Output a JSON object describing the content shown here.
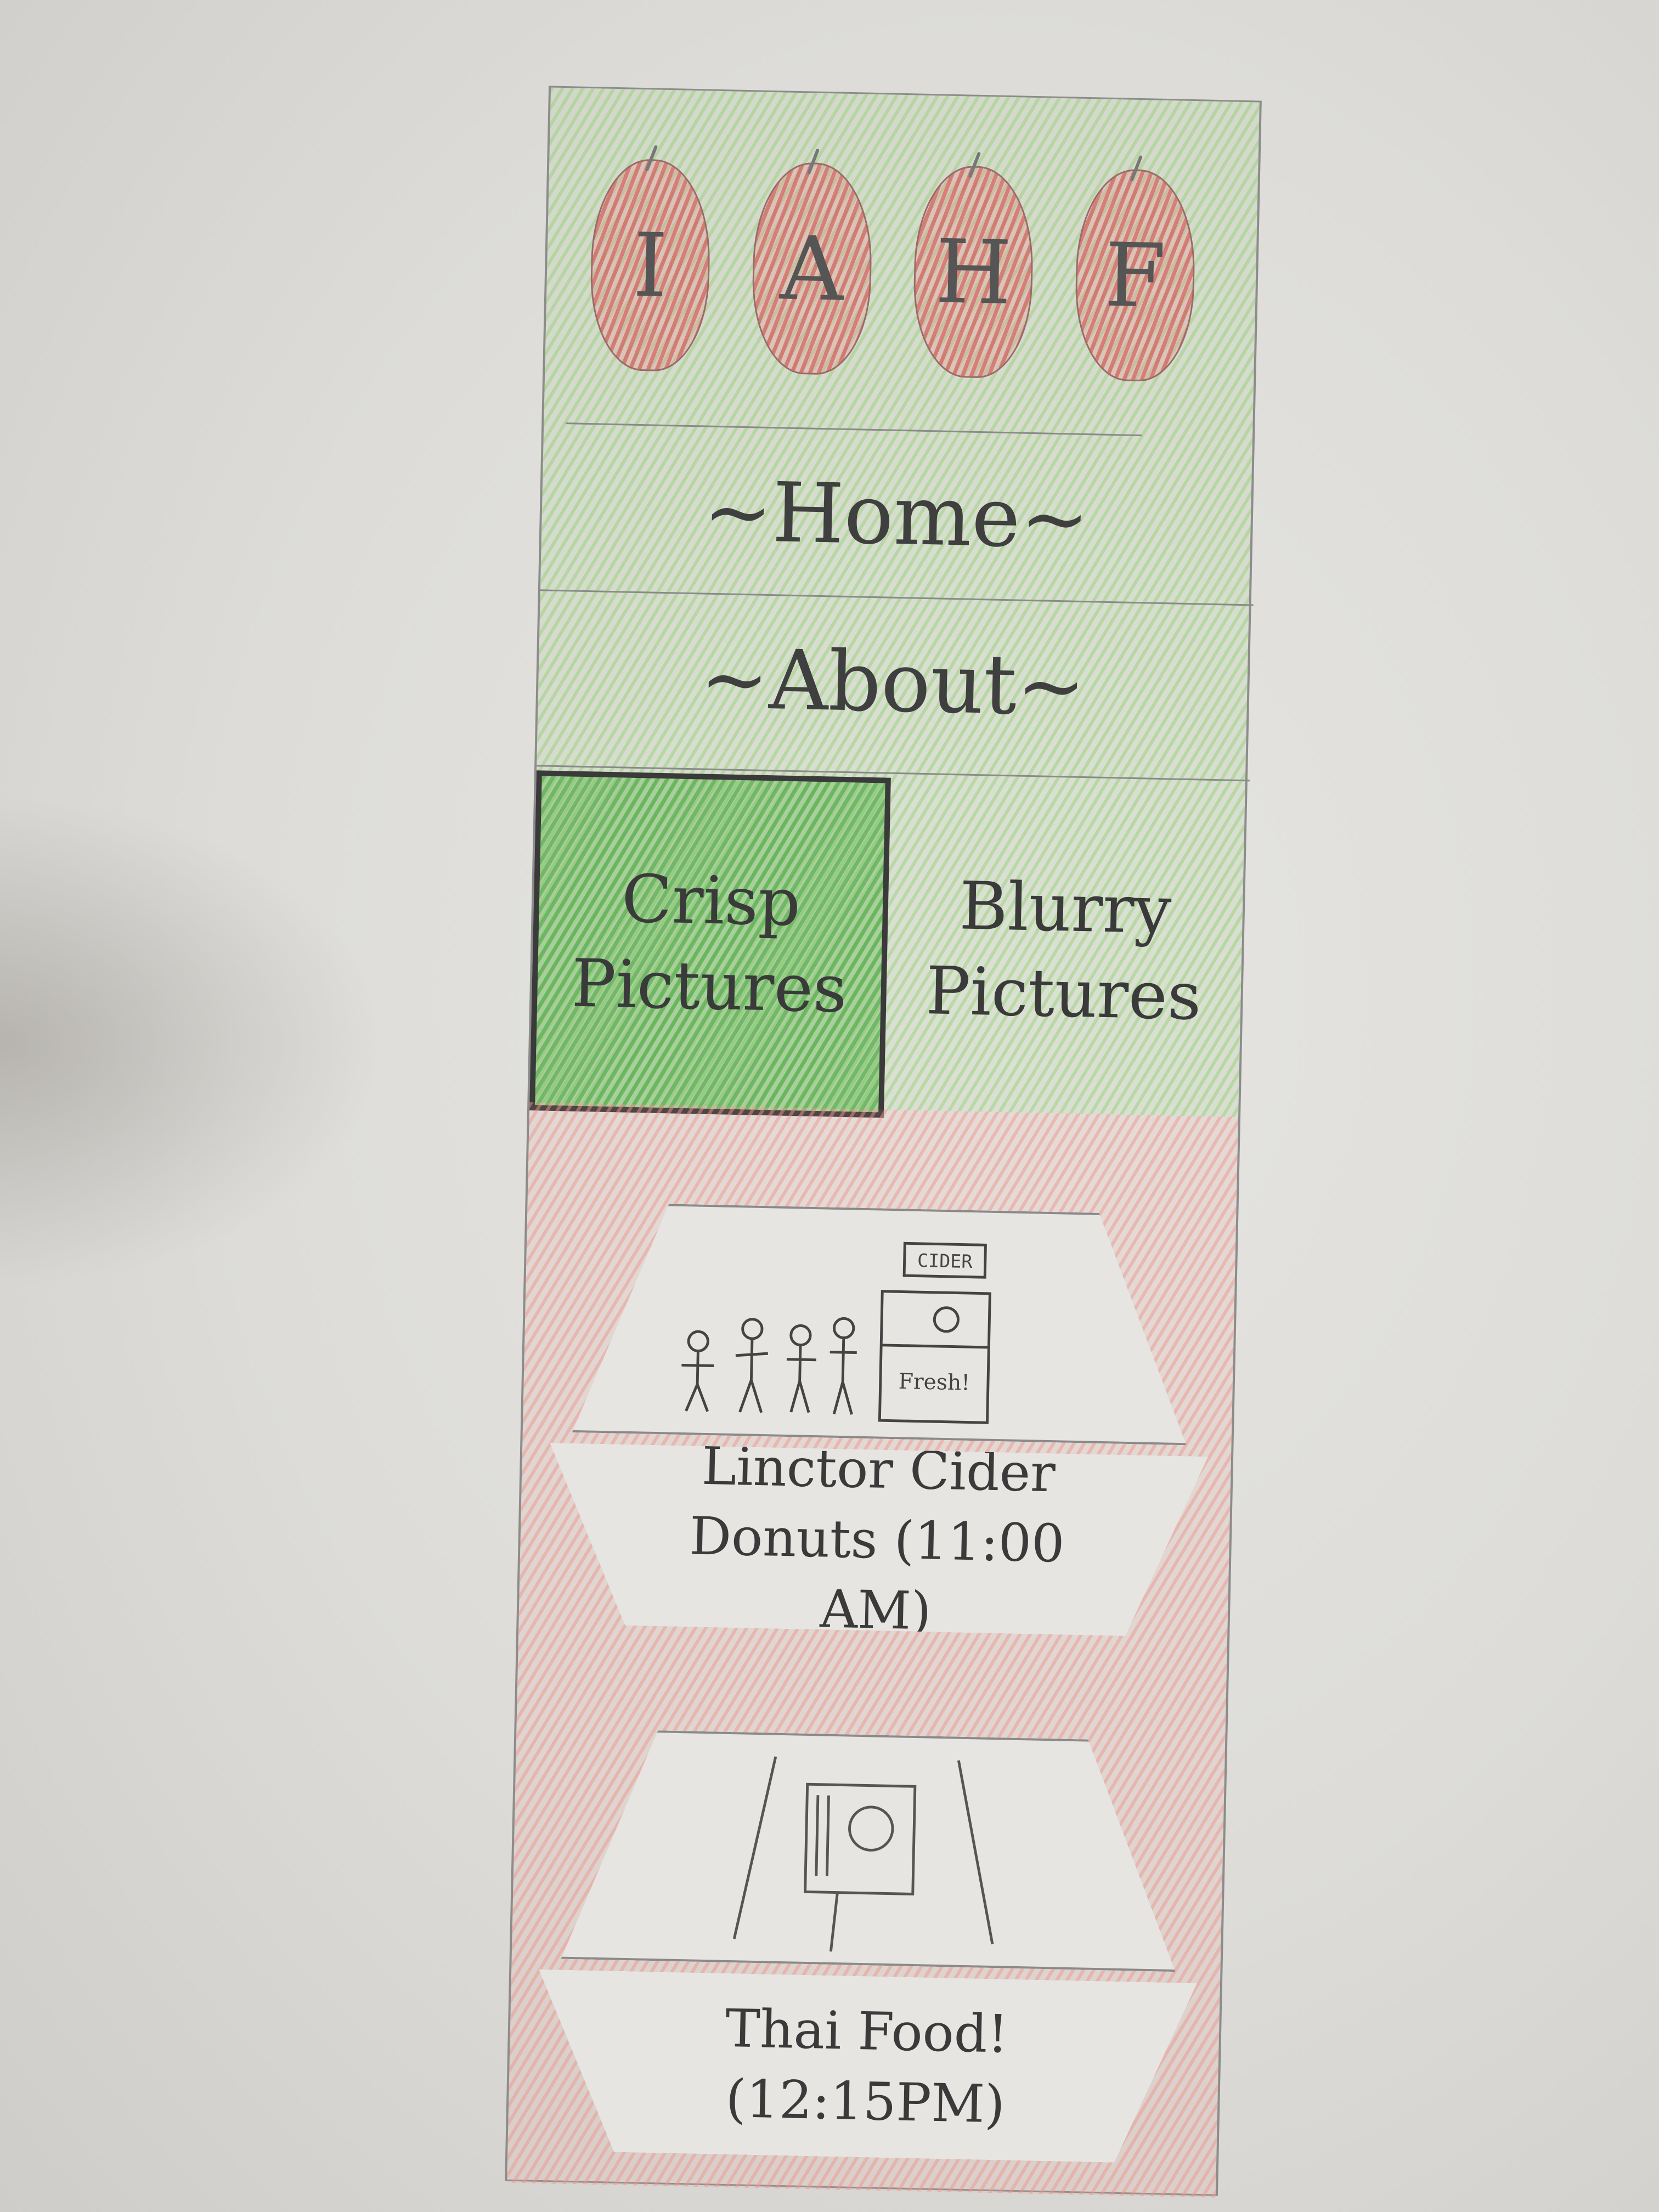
{
  "logo": {
    "letters": [
      "I",
      "A",
      "H",
      "F"
    ]
  },
  "nav": {
    "home_label": "~Home~",
    "about_label": "~About~"
  },
  "toggle": {
    "crisp_label": "Crisp Pictures",
    "blurry_label": "Blurry Pictures",
    "selected": "crisp"
  },
  "feed": [
    {
      "scene": {
        "sign_text": "CIDER",
        "stand_text": "Fresh!"
      },
      "caption": "Linctor Cider Donuts (11:00 AM)"
    },
    {
      "caption": "Thai Food! (12:15PM)"
    }
  ],
  "colors": {
    "header_green": "#96cd78",
    "active_green": "#50aa46",
    "feed_red": "#ec968c",
    "apple_red": "#d75f5f"
  }
}
